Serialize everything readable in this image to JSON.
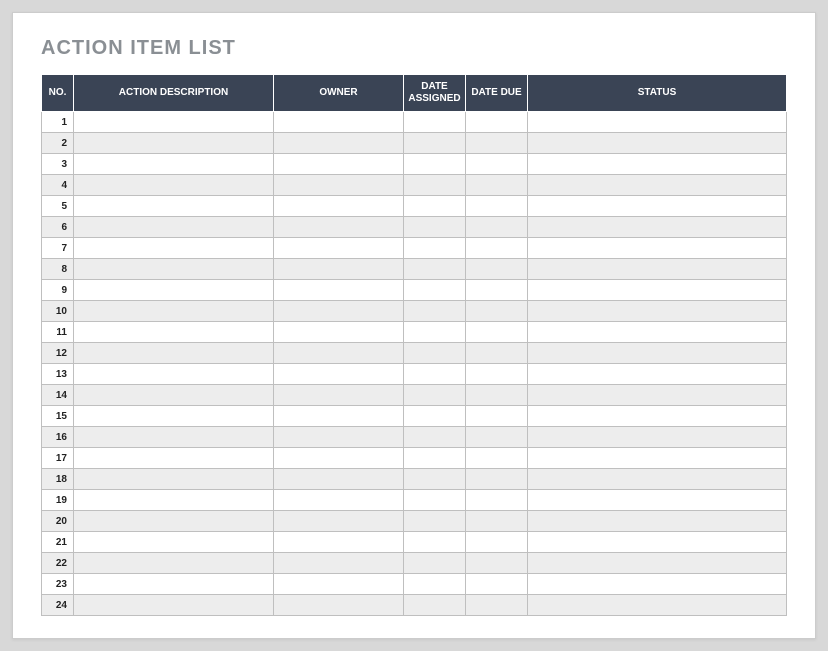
{
  "title": "ACTION ITEM LIST",
  "columns": {
    "no": "NO.",
    "action_description": "ACTION DESCRIPTION",
    "owner": "OWNER",
    "date_assigned": "DATE ASSIGNED",
    "date_due": "DATE DUE",
    "status": "STATUS"
  },
  "rows": [
    {
      "no": "1",
      "action_description": "",
      "owner": "",
      "date_assigned": "",
      "date_due": "",
      "status": ""
    },
    {
      "no": "2",
      "action_description": "",
      "owner": "",
      "date_assigned": "",
      "date_due": "",
      "status": ""
    },
    {
      "no": "3",
      "action_description": "",
      "owner": "",
      "date_assigned": "",
      "date_due": "",
      "status": ""
    },
    {
      "no": "4",
      "action_description": "",
      "owner": "",
      "date_assigned": "",
      "date_due": "",
      "status": ""
    },
    {
      "no": "5",
      "action_description": "",
      "owner": "",
      "date_assigned": "",
      "date_due": "",
      "status": ""
    },
    {
      "no": "6",
      "action_description": "",
      "owner": "",
      "date_assigned": "",
      "date_due": "",
      "status": ""
    },
    {
      "no": "7",
      "action_description": "",
      "owner": "",
      "date_assigned": "",
      "date_due": "",
      "status": ""
    },
    {
      "no": "8",
      "action_description": "",
      "owner": "",
      "date_assigned": "",
      "date_due": "",
      "status": ""
    },
    {
      "no": "9",
      "action_description": "",
      "owner": "",
      "date_assigned": "",
      "date_due": "",
      "status": ""
    },
    {
      "no": "10",
      "action_description": "",
      "owner": "",
      "date_assigned": "",
      "date_due": "",
      "status": ""
    },
    {
      "no": "11",
      "action_description": "",
      "owner": "",
      "date_assigned": "",
      "date_due": "",
      "status": ""
    },
    {
      "no": "12",
      "action_description": "",
      "owner": "",
      "date_assigned": "",
      "date_due": "",
      "status": ""
    },
    {
      "no": "13",
      "action_description": "",
      "owner": "",
      "date_assigned": "",
      "date_due": "",
      "status": ""
    },
    {
      "no": "14",
      "action_description": "",
      "owner": "",
      "date_assigned": "",
      "date_due": "",
      "status": ""
    },
    {
      "no": "15",
      "action_description": "",
      "owner": "",
      "date_assigned": "",
      "date_due": "",
      "status": ""
    },
    {
      "no": "16",
      "action_description": "",
      "owner": "",
      "date_assigned": "",
      "date_due": "",
      "status": ""
    },
    {
      "no": "17",
      "action_description": "",
      "owner": "",
      "date_assigned": "",
      "date_due": "",
      "status": ""
    },
    {
      "no": "18",
      "action_description": "",
      "owner": "",
      "date_assigned": "",
      "date_due": "",
      "status": ""
    },
    {
      "no": "19",
      "action_description": "",
      "owner": "",
      "date_assigned": "",
      "date_due": "",
      "status": ""
    },
    {
      "no": "20",
      "action_description": "",
      "owner": "",
      "date_assigned": "",
      "date_due": "",
      "status": ""
    },
    {
      "no": "21",
      "action_description": "",
      "owner": "",
      "date_assigned": "",
      "date_due": "",
      "status": ""
    },
    {
      "no": "22",
      "action_description": "",
      "owner": "",
      "date_assigned": "",
      "date_due": "",
      "status": ""
    },
    {
      "no": "23",
      "action_description": "",
      "owner": "",
      "date_assigned": "",
      "date_due": "",
      "status": ""
    },
    {
      "no": "24",
      "action_description": "",
      "owner": "",
      "date_assigned": "",
      "date_due": "",
      "status": ""
    }
  ]
}
